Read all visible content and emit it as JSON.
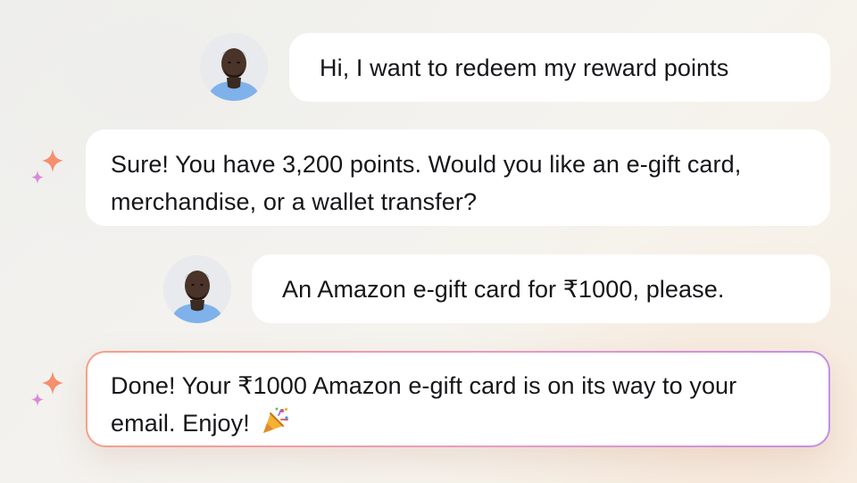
{
  "messages": [
    {
      "role": "user",
      "text": "Hi, I want to redeem my reward points",
      "avatar_icon": "user-avatar"
    },
    {
      "role": "assistant",
      "text": "Sure! You have 3,200 points. Would you like an e-gift card, merchandise, or a wallet transfer?",
      "icon": "sparkle-icon"
    },
    {
      "role": "user",
      "text": "An Amazon e-gift card for ₹1000, please.",
      "avatar_icon": "user-avatar"
    },
    {
      "role": "assistant",
      "text": "Done! Your ₹1000 Amazon e-gift card is on its way to your email. Enjoy!",
      "emoji_icon": "party-popper-icon",
      "icon": "sparkle-icon",
      "highlighted": true
    }
  ],
  "colors": {
    "sparkle_large": "#f58f6e",
    "sparkle_small": "#d98ad6",
    "highlight_border_start": "#f5a08a",
    "highlight_border_end": "#c58ee6",
    "avatar_bg": "#e8eaed",
    "shirt": "#7fb2ea"
  }
}
